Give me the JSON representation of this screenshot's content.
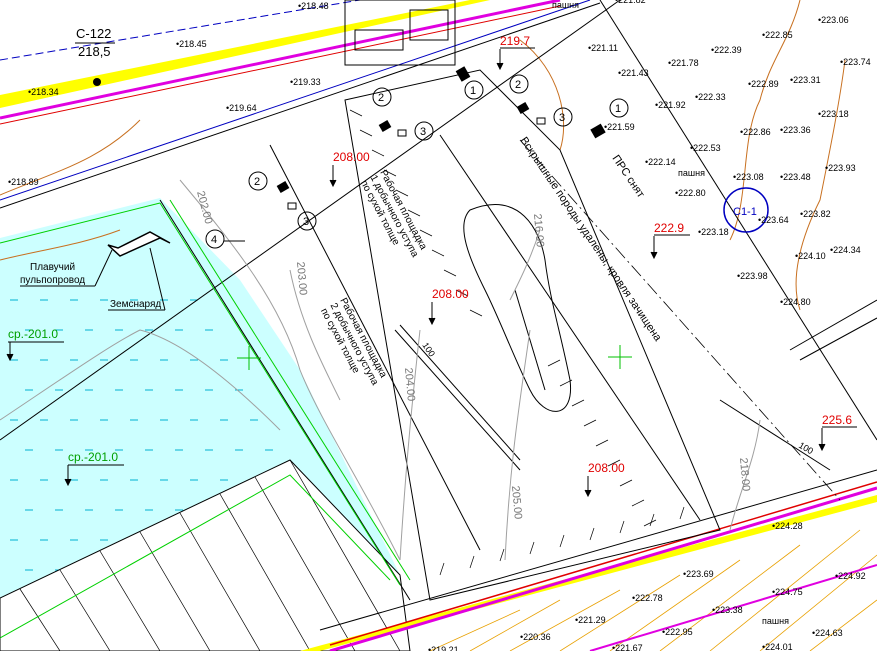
{
  "colors": {
    "water": "#ccffff",
    "road_magenta": "#e000e0",
    "red_line": "#e00000",
    "yellow": "#ffff00",
    "contour_brown": "#c87020",
    "blue": "#0000c0",
    "green": "#00d000",
    "cyan_line": "#00c0ff",
    "orange_hatch": "#e8a000"
  },
  "header": {
    "marker_code": "С-122",
    "marker_elev": "218,5"
  },
  "levels": {
    "red_208_a": "208.00",
    "red_208_b": "208.00",
    "red_208_c": "208.00",
    "red_219": "219.7",
    "red_222": "222.9",
    "red_225": "225.6"
  },
  "water_levels": {
    "level_1": "ср.-201.0",
    "level_2": "ср.-201.0"
  },
  "contours": {
    "c202": "202.00",
    "c203": "203.00",
    "c204": "204.00",
    "c205": "205.00",
    "c216": "216.00",
    "c218": "218.00"
  },
  "texts": {
    "work_platform_1": [
      "Рабочая площадка",
      "1 добычного уступа",
      "по сухой толще"
    ],
    "work_platform_2": [
      "Рабочая площадка",
      "2 добычного уступа",
      "по сухой толще"
    ],
    "overburden": "Вскрышные породы удалены, кровля зачищена",
    "prs": "ПРС снят",
    "pasture_1": "пашня",
    "pasture_2": "пашня",
    "pasture_3": "пашня",
    "floating_pipe": [
      "Плавучий",
      "пульпопровод"
    ],
    "dredger": "Земснаряд",
    "section": "С1-1",
    "small_100_a": "100",
    "small_100_b": "100"
  },
  "callouts": [
    "1",
    "1",
    "1",
    "2",
    "2",
    "2",
    "3",
    "3",
    "3",
    "4"
  ],
  "spot_heights": [
    "218.48",
    "218.45",
    "218.34",
    "219.33",
    "219.64",
    "218.89",
    "221.11",
    "221.43",
    "221.78",
    "221.59",
    "221.92",
    "222.39",
    "222.33",
    "222.14",
    "222.53",
    "222.80",
    "223.06",
    "222.85",
    "222.89",
    "223.31",
    "223.74",
    "222.86",
    "223.36",
    "223.18",
    "223.08",
    "223.48",
    "223.93",
    "223.18",
    "223.64",
    "223.82",
    "224.10",
    "224.34",
    "223.98",
    "224.80",
    "224.28",
    "223.69",
    "222.78",
    "222.95",
    "223.38",
    "224.75",
    "224.92",
    "224.63",
    "224.01",
    "221.29",
    "220.36",
    "219.21",
    "221.67",
    "221.82"
  ]
}
